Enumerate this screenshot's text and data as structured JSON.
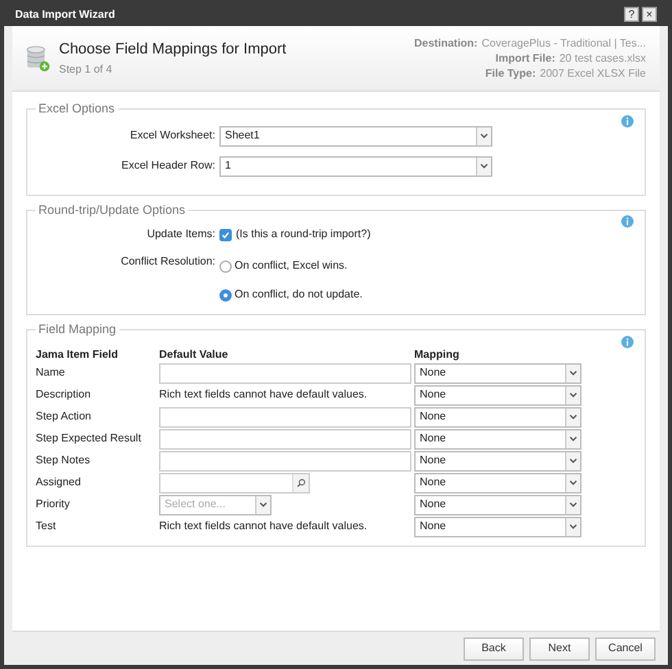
{
  "window": {
    "title": "Data Import Wizard",
    "buttons": [
      "?",
      "×"
    ]
  },
  "header": {
    "title": "Choose Field Mappings for Import",
    "step": "Step 1 of 4",
    "info": [
      {
        "label": "Destination:",
        "value": "CoveragePlus - Traditional | Tes..."
      },
      {
        "label": "Import File:",
        "value": "20 test cases.xlsx"
      },
      {
        "label": "File Type:",
        "value": "2007 Excel XLSX File"
      }
    ]
  },
  "excel_options": {
    "legend": "Excel Options",
    "fields": [
      {
        "label": "Excel Worksheet:",
        "value": "Sheet1"
      },
      {
        "label": "Excel Header Row:",
        "value": "1"
      }
    ]
  },
  "update_options": {
    "legend": "Round-trip/Update Options",
    "update_items": {
      "label": "Update Items:",
      "text": "(Is this a round-trip import?)",
      "checked": true
    },
    "conflict": {
      "label": "Conflict Resolution:",
      "options": [
        {
          "label": "On conflict, Excel wins.",
          "selected": false
        },
        {
          "label": "On conflict, do not update.",
          "selected": true
        }
      ]
    }
  },
  "field_mapping": {
    "legend": "Field Mapping",
    "columns": [
      "Jama Item Field",
      "Default Value",
      "Mapping"
    ],
    "rows": [
      {
        "field": "Name",
        "kind": "input",
        "mapping": "None"
      },
      {
        "field": "Description",
        "kind": "note",
        "default": "Rich text fields cannot have default values.",
        "mapping": "None"
      },
      {
        "field": "Step Action",
        "kind": "input",
        "mapping": "None"
      },
      {
        "field": "Step Expected Result",
        "kind": "input",
        "mapping": "None"
      },
      {
        "field": "Step Notes",
        "kind": "input",
        "mapping": "None"
      },
      {
        "field": "Assigned",
        "kind": "lookup",
        "mapping": "None"
      },
      {
        "field": "Priority",
        "kind": "select",
        "placeholder": "Select one...",
        "mapping": "None"
      },
      {
        "field": "Test",
        "kind": "note",
        "default": "Rich text fields cannot have default values.",
        "mapping": "None"
      }
    ]
  },
  "footer": {
    "buttons": [
      "Back",
      "Next",
      "Cancel"
    ]
  }
}
